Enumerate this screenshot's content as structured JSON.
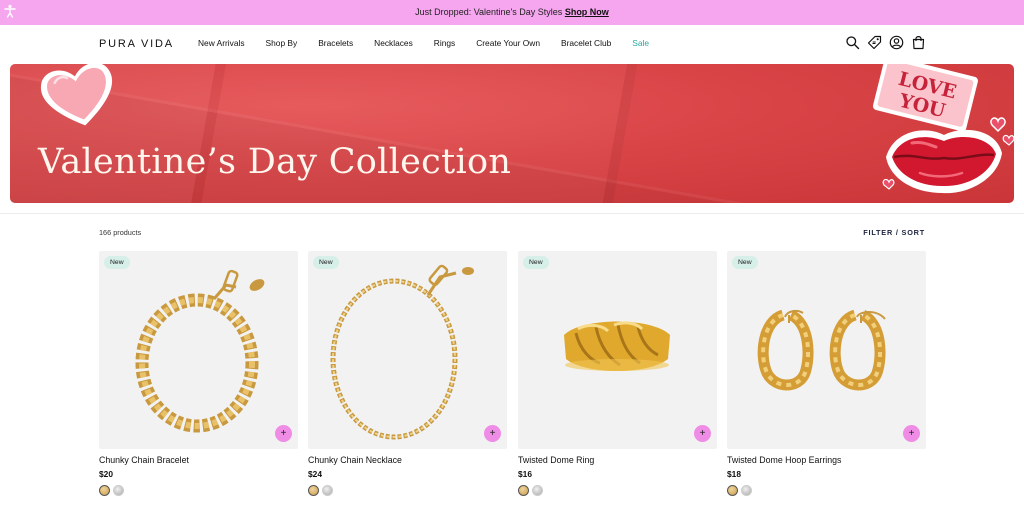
{
  "announcement": {
    "text": "Just Dropped: Valentine's Day Styles",
    "link": "Shop Now"
  },
  "header": {
    "logo": "PURA VIDA",
    "nav": [
      "New Arrivals",
      "Shop By",
      "Bracelets",
      "Necklaces",
      "Rings",
      "Create Your Own",
      "Bracelet Club",
      "Sale"
    ],
    "icons": [
      "search-icon",
      "rewards-tag-icon",
      "account-icon",
      "cart-icon"
    ],
    "sale_color": "#2aa7a1"
  },
  "hero": {
    "title": "Valentine’s Day Collection",
    "sticker_text": [
      "LOVE",
      "YOU"
    ],
    "background": "#d94447"
  },
  "listing": {
    "count": "166 products",
    "filter": "FILTER / SORT"
  },
  "products": [
    {
      "badge": "New",
      "name": "Chunky Chain Bracelet",
      "price": "$20",
      "swatches": [
        "gold",
        "silver"
      ]
    },
    {
      "badge": "New",
      "name": "Chunky Chain Necklace",
      "price": "$24",
      "swatches": [
        "gold",
        "silver"
      ]
    },
    {
      "badge": "New",
      "name": "Twisted Dome Ring",
      "price": "$16",
      "swatches": [
        "gold",
        "silver"
      ]
    },
    {
      "badge": "New",
      "name": "Twisted Dome Hoop Earrings",
      "price": "$18",
      "swatches": [
        "gold",
        "silver"
      ]
    }
  ],
  "add_symbol": "+",
  "colors": {
    "announcement_bg": "#f6a6ee",
    "badge_bg": "#d6efe8",
    "add_button": "#ee8ce6"
  }
}
